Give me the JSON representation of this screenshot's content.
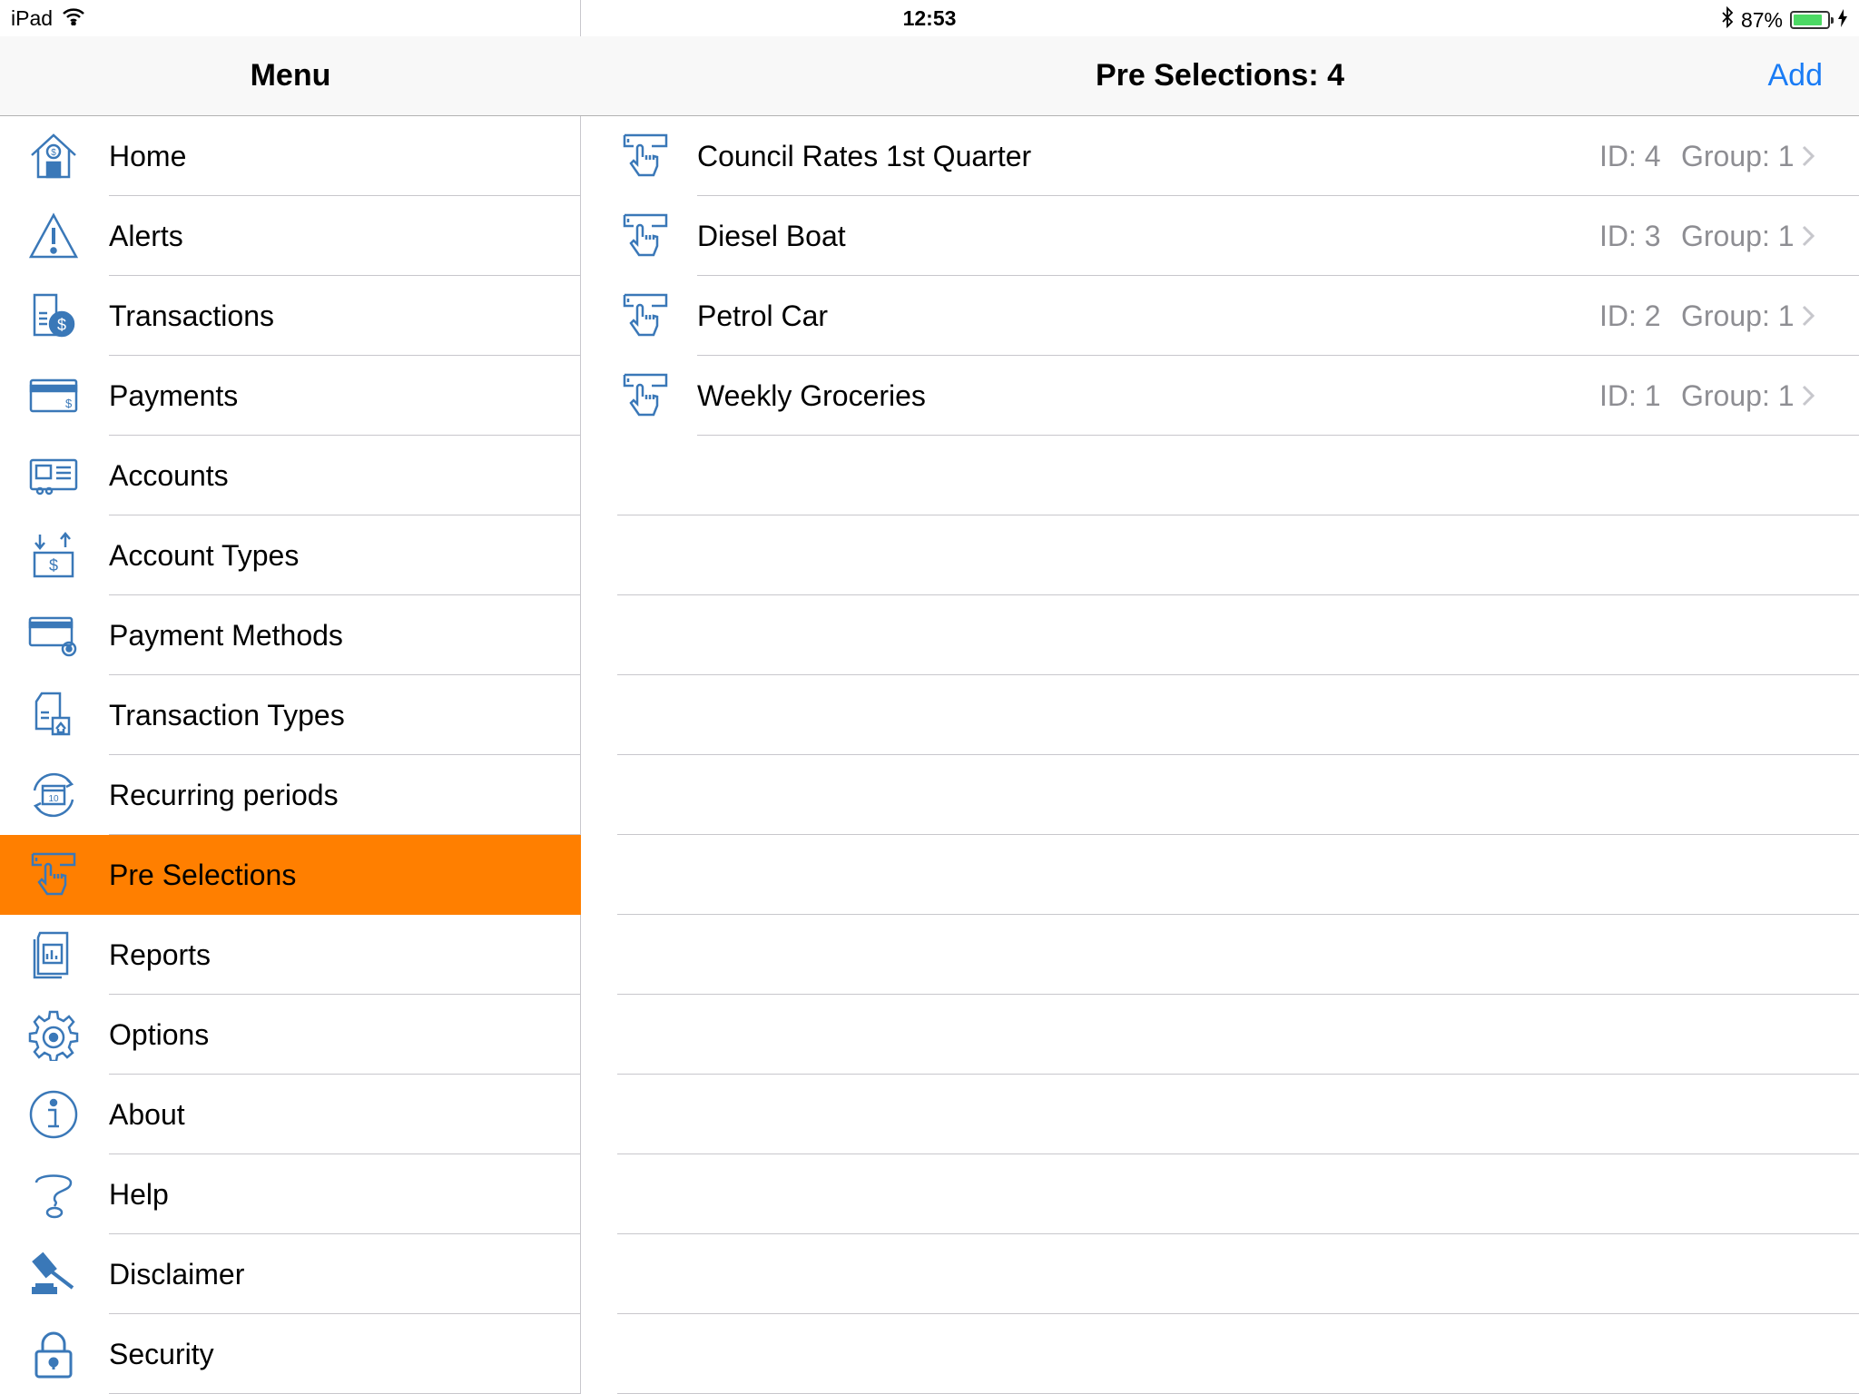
{
  "status_bar": {
    "device": "iPad",
    "time": "12:53",
    "battery_percent": "87%",
    "battery_level": 0.87
  },
  "sidebar": {
    "title": "Menu",
    "items": [
      {
        "label": "Home",
        "icon": "home-dollar-icon"
      },
      {
        "label": "Alerts",
        "icon": "alert-triangle-icon"
      },
      {
        "label": "Transactions",
        "icon": "transactions-icon"
      },
      {
        "label": "Payments",
        "icon": "payment-card-icon"
      },
      {
        "label": "Accounts",
        "icon": "accounts-icon"
      },
      {
        "label": "Account Types",
        "icon": "account-types-icon"
      },
      {
        "label": "Payment Methods",
        "icon": "payment-methods-icon"
      },
      {
        "label": "Transaction Types",
        "icon": "transaction-types-icon"
      },
      {
        "label": "Recurring periods",
        "icon": "recurring-calendar-icon"
      },
      {
        "label": "Pre Selections",
        "icon": "pre-selection-hand-icon",
        "selected": true
      },
      {
        "label": "Reports",
        "icon": "reports-icon"
      },
      {
        "label": "Options",
        "icon": "gear-icon"
      },
      {
        "label": "About",
        "icon": "info-icon"
      },
      {
        "label": "Help",
        "icon": "help-question-icon"
      },
      {
        "label": "Disclaimer",
        "icon": "gavel-icon"
      },
      {
        "label": "Security",
        "icon": "padlock-icon"
      }
    ]
  },
  "main": {
    "title": "Pre Selections: 4",
    "add_label": "Add",
    "rows": [
      {
        "title": "Council Rates 1st Quarter",
        "id": "ID: 4",
        "group": "Group: 1"
      },
      {
        "title": "Diesel Boat",
        "id": "ID: 3",
        "group": "Group: 1"
      },
      {
        "title": "Petrol Car",
        "id": "ID: 2",
        "group": "Group: 1"
      },
      {
        "title": "Weekly Groceries",
        "id": "ID: 1",
        "group": "Group: 1"
      }
    ]
  },
  "colors": {
    "accent_selected": "#ff7f00",
    "icon_blue": "#3a78b8",
    "link_blue": "#1a7cf5",
    "secondary_text": "#8e8e93"
  }
}
